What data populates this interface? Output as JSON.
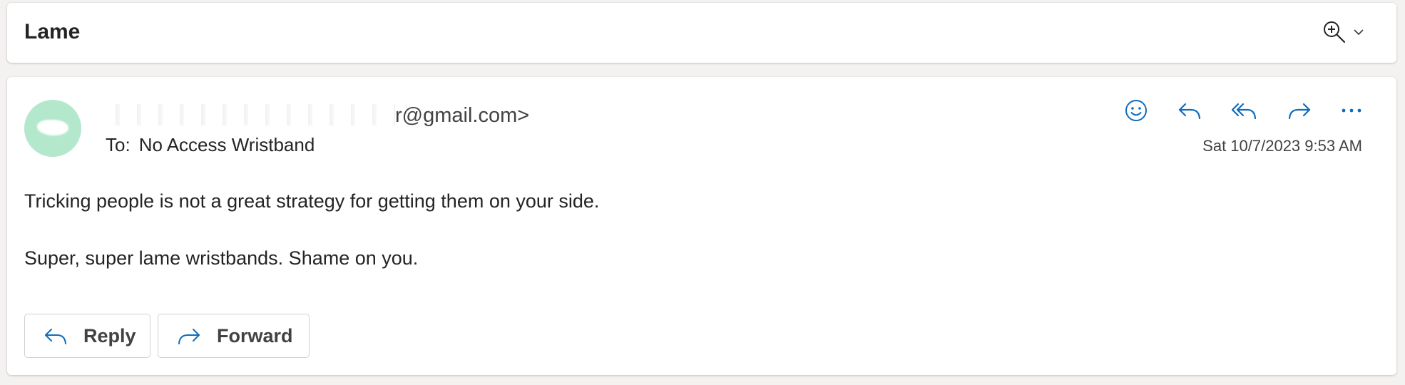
{
  "subject": {
    "title": "Lame"
  },
  "message": {
    "sender_visible": "r@gmail.com>",
    "to_label": "To:",
    "to_value": "No Access Wristband",
    "timestamp": "Sat 10/7/2023 9:53 AM",
    "body": [
      "Tricking people is not a great strategy for getting them on your side.",
      "Super, super lame wristbands. Shame on you."
    ],
    "avatar_color": "#b3e8cd"
  },
  "actions": {
    "reply_label": "Reply",
    "forward_label": "Forward"
  },
  "icons": {
    "subject": [
      "zoom-in-icon",
      "chevron-down-icon"
    ],
    "header": [
      "emoji-icon",
      "reply-icon",
      "reply-all-icon",
      "forward-icon",
      "more-icon"
    ]
  },
  "colors": {
    "accent": "#0f6cbd",
    "text": "#242424"
  }
}
